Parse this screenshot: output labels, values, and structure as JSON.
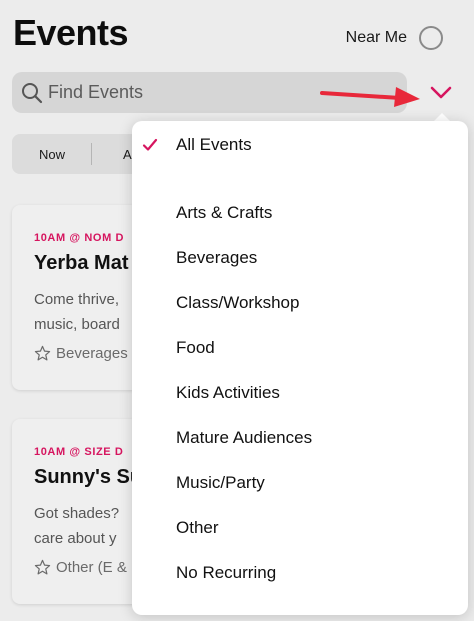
{
  "header": {
    "title": "Events",
    "near_me_label": "Near Me"
  },
  "search": {
    "placeholder": "Find Events"
  },
  "filters": {
    "tabs": [
      "Now",
      "All"
    ]
  },
  "cards": [
    {
      "time": "10AM @ NOM D",
      "title": "Yerba Mat",
      "description": [
        "Come thrive,",
        "music, board"
      ],
      "tag": "Beverages"
    },
    {
      "time": "10AM @ SIZE D",
      "title": "Sunny's Su",
      "description": [
        "Got shades?",
        "care about y"
      ],
      "tag": "Other (E &"
    }
  ],
  "dropdown": {
    "selected": "All Events",
    "items": [
      "Arts & Crafts",
      "Beverages",
      "Class/Workshop",
      "Food",
      "Kids Activities",
      "Mature Audiences",
      "Music/Party",
      "Other",
      "No Recurring"
    ]
  },
  "colors": {
    "accent": "#d6155f",
    "arrow": "#e8283a"
  },
  "icons": {
    "search": "search-icon",
    "check": "check-icon",
    "chevron": "chevron-down-icon",
    "star": "star-outline-icon"
  }
}
